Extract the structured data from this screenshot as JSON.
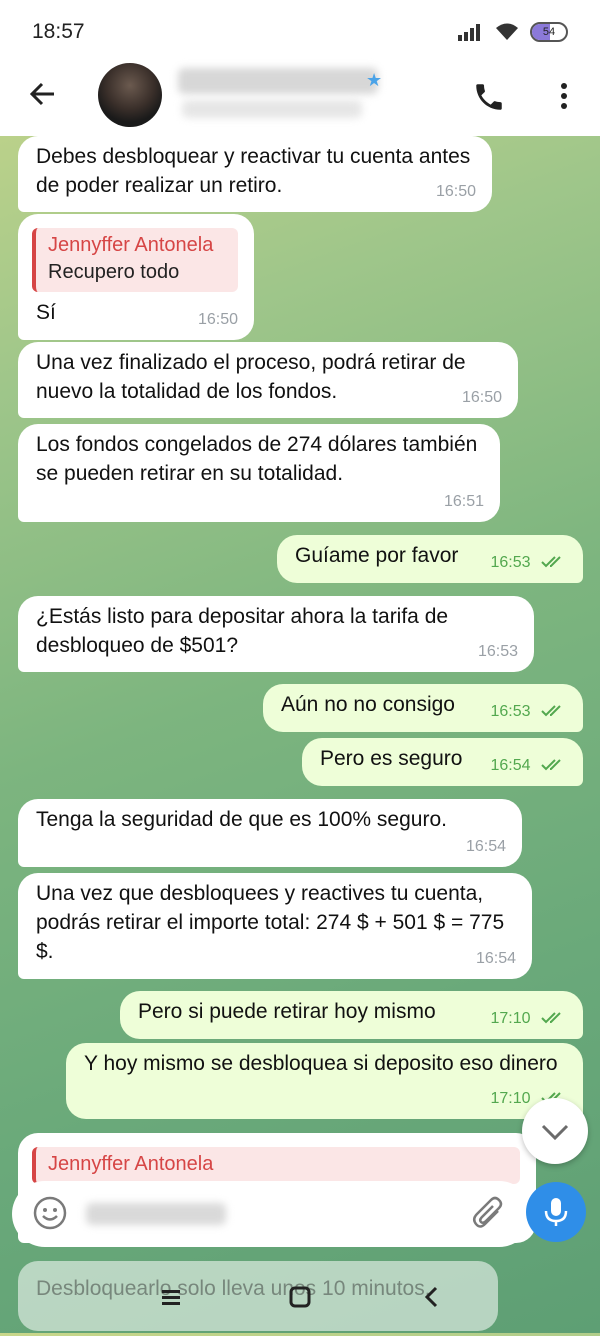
{
  "status": {
    "time": "18:57",
    "battery": "54"
  },
  "messages": [
    {
      "text": "Debes desbloquear y reactivar tu cuenta antes de poder realizar un retiro.",
      "time": "16:50"
    },
    {
      "reply_name": "Jennyffer Antonela",
      "reply_text": "Recupero todo",
      "text": "Sí",
      "time": "16:50"
    },
    {
      "text": "Una vez finalizado el proceso, podrá retirar de nuevo la totalidad de los fondos.",
      "time": "16:50"
    },
    {
      "text": "Los fondos congelados de 274 dólares también se pueden retirar en su totalidad.",
      "time": "16:51"
    },
    {
      "text": "Guíame por favor",
      "time": "16:53"
    },
    {
      "text": "¿Estás listo para depositar ahora la tarifa de desbloqueo de $501?",
      "time": "16:53"
    },
    {
      "text": "Aún no no consigo",
      "time": "16:53"
    },
    {
      "text": "Pero es seguro",
      "time": "16:54"
    },
    {
      "text": "Tenga la seguridad de que es 100% seguro.",
      "time": "16:54"
    },
    {
      "text": "Una vez que desbloquees y reactives tu cuenta, podrás retirar el importe total: 274 $ + 501 $ = 775 $.",
      "time": "16:54"
    },
    {
      "text": "Pero si puede retirar hoy mismo",
      "time": "17:10"
    },
    {
      "text": "Y hoy mismo se desbloquea si deposito eso dinero",
      "time": "17:10"
    },
    {
      "reply_name": "Jennyffer Antonela"
    },
    {
      "text": "Desbloquearlo solo lleva unos 10 minutos."
    }
  ]
}
